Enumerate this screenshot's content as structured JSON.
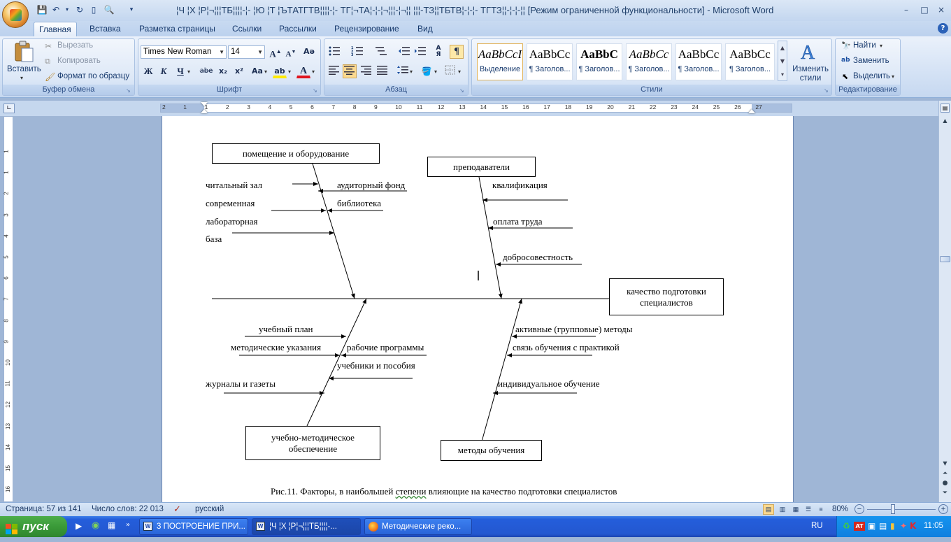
{
  "window": {
    "title": "¦Ч ¦Х ¦Р¦¬¦¦¦ТБ¦¦¦¦-¦-   ¦Ю ¦Т ¦ЪТАТГТВ¦¦¦¦-¦- ТГ¦¬ТА¦-¦-¦¬¦¦¦-¦¬¦¦ ¦¦¦-ТЗ¦¦ТБТВ¦-¦-¦- ТГТЗ¦¦-¦-¦-¦¦ [Режим ограниченной функциональности] - Microsoft Word",
    "minimize": "–",
    "maximize": "□",
    "close": "×"
  },
  "tabs": [
    "Главная",
    "Вставка",
    "Разметка страницы",
    "Ссылки",
    "Рассылки",
    "Рецензирование",
    "Вид"
  ],
  "clipboard": {
    "paste": "Вставить",
    "cut": "Вырезать",
    "copy": "Копировать",
    "format_painter": "Формат по образцу",
    "label": "Буфер обмена"
  },
  "font": {
    "name": "Times New Roman",
    "size": "14",
    "bold": "Ж",
    "italic": "К",
    "underline": "Ч",
    "strike": "abe",
    "subscript": "x₂",
    "superscript": "x²",
    "change_case": "Aa",
    "label": "Шрифт"
  },
  "paragraph": {
    "label": "Абзац"
  },
  "styles": {
    "items": [
      {
        "sample": "AaBbCcI",
        "name": "Выделение"
      },
      {
        "sample": "AaBbCc",
        "name": "¶ Заголов..."
      },
      {
        "sample": "AaBbC",
        "name": "¶ Заголов..."
      },
      {
        "sample": "AaBbCc",
        "name": "¶ Заголов..."
      },
      {
        "sample": "AaBbCc",
        "name": "¶ Заголов..."
      },
      {
        "sample": "AaBbCc",
        "name": "¶ Заголов..."
      }
    ],
    "change": "Изменить стили",
    "label": "Стили"
  },
  "editing": {
    "find": "Найти",
    "replace": "Заменить",
    "select": "Выделить",
    "label": "Редактирование"
  },
  "hruler_numbers": [
    "2",
    "1",
    "1",
    "2",
    "3",
    "4",
    "5",
    "6",
    "7",
    "8",
    "9",
    "10",
    "11",
    "12",
    "13",
    "14",
    "15",
    "16",
    "17",
    "18",
    "19",
    "20",
    "21",
    "22",
    "23",
    "24",
    "25",
    "26",
    "27"
  ],
  "vruler_numbers": [
    "1",
    "1",
    "2",
    "3",
    "4",
    "5",
    "6",
    "7",
    "8",
    "9",
    "10",
    "11",
    "12",
    "13",
    "14",
    "15",
    "16"
  ],
  "diagram": {
    "effect": "качество подготовки специалистов",
    "categories": {
      "premises": "помещение и оборудование",
      "teachers": "преподаватели",
      "methodical": "учебно-методическое обеспечение",
      "methods": "методы обучения"
    },
    "causes": {
      "reading_hall": "читальный зал",
      "modern": "современная",
      "laboratory": "лабораторная",
      "base": "база",
      "classroom_fund": "аудиторный фонд",
      "library": "библиотека",
      "qualification": "квалификация",
      "salary": "оплата труда",
      "conscientiousness": "добросовестность",
      "curriculum": "учебный план",
      "guidelines": "методические указания",
      "work_programs": "рабочие программы",
      "textbooks": "учебники и пособия",
      "journals": "журналы и газеты",
      "active_methods": "активные (групповые) методы",
      "practice_link": "связь обучения с практикой",
      "individual": "индивидуальное обучение"
    },
    "caption_prefix": "Рис.11. Факторы, в наибольшей ",
    "caption_word": "степени",
    "caption_suffix": " влияющие на качество подготовки специалистов"
  },
  "status": {
    "page": "Страница: 57 из 141",
    "words": "Число слов: 22 013",
    "language": "русский",
    "zoom": "80%"
  },
  "taskbar": {
    "start": "пуск",
    "tasks": [
      "3 ПОСТРОЕНИЕ ПРИ...",
      "¦Ч ¦Х ¦Р¦¬¦¦¦ТБ¦¦¦¦-...",
      "Методические реко..."
    ],
    "lang": "RU",
    "clock": "11:05"
  },
  "colors": {
    "accent": "#1c3f78",
    "ribbon": "#dde8f7",
    "taskbar": "#245edb",
    "start": "#3a9a38"
  }
}
